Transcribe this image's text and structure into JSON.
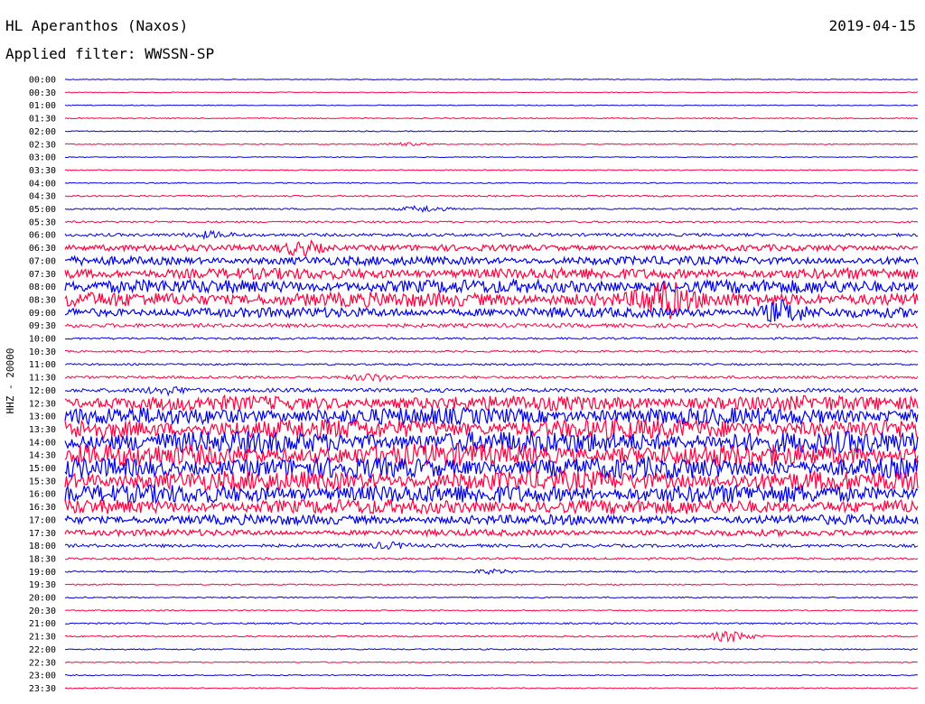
{
  "header": {
    "station": "HL Aperanthos (Naxos)",
    "date": "2019-04-15",
    "filter": "Applied filter: WWSSN-SP"
  },
  "chart_data": {
    "type": "line",
    "title": "HL Aperanthos (Naxos)",
    "subtitle": "Applied filter: WWSSN-SP",
    "date": "2019-04-15",
    "ylabel": "HHZ - 20000",
    "xlabel": "",
    "x_minutes_per_line": 30,
    "series_colors": [
      "#0000e6",
      "#ff0040"
    ],
    "row_labels": [
      "00:00",
      "00:30",
      "01:00",
      "01:30",
      "02:00",
      "02:30",
      "03:00",
      "03:30",
      "04:00",
      "04:30",
      "05:00",
      "05:30",
      "06:00",
      "06:30",
      "07:00",
      "07:30",
      "08:00",
      "08:30",
      "09:00",
      "09:30",
      "10:00",
      "10:30",
      "11:00",
      "11:30",
      "12:00",
      "12:30",
      "13:00",
      "13:30",
      "14:00",
      "14:30",
      "15:00",
      "15:30",
      "16:00",
      "16:30",
      "17:00",
      "17:30",
      "18:00",
      "18:30",
      "19:00",
      "19:30",
      "20:00",
      "20:30",
      "21:00",
      "21:30",
      "22:00",
      "22:30",
      "23:00",
      "23:30"
    ],
    "noise_amplitude": [
      0.3,
      0.3,
      0.3,
      0.4,
      0.4,
      0.4,
      0.3,
      0.4,
      0.4,
      0.6,
      0.6,
      0.7,
      1.2,
      2.5,
      3.5,
      4.5,
      5.5,
      6.0,
      4.0,
      1.5,
      0.8,
      0.7,
      0.7,
      1.0,
      1.5,
      6.0,
      7.0,
      8.0,
      9.0,
      9.0,
      8.5,
      8.0,
      7.5,
      6.0,
      4.0,
      2.5,
      1.2,
      0.8,
      0.6,
      0.5,
      0.5,
      0.5,
      0.6,
      0.6,
      0.5,
      0.4,
      0.4,
      0.4
    ],
    "events": [
      {
        "row": 5,
        "x_fraction": 0.4,
        "amplitude": 1.0
      },
      {
        "row": 10,
        "x_fraction": 0.42,
        "amplitude": 2.2
      },
      {
        "row": 12,
        "x_fraction": 0.17,
        "amplitude": 2.0
      },
      {
        "row": 13,
        "x_fraction": 0.28,
        "amplitude": 8.0
      },
      {
        "row": 17,
        "x_fraction": 0.7,
        "amplitude": 12.0
      },
      {
        "row": 18,
        "x_fraction": 0.84,
        "amplitude": 10.0
      },
      {
        "row": 23,
        "x_fraction": 0.36,
        "amplitude": 2.5
      },
      {
        "row": 24,
        "x_fraction": 0.12,
        "amplitude": 2.5
      },
      {
        "row": 36,
        "x_fraction": 0.38,
        "amplitude": 2.0
      },
      {
        "row": 38,
        "x_fraction": 0.5,
        "amplitude": 1.5
      },
      {
        "row": 43,
        "x_fraction": 0.78,
        "amplitude": 4.0
      }
    ]
  }
}
